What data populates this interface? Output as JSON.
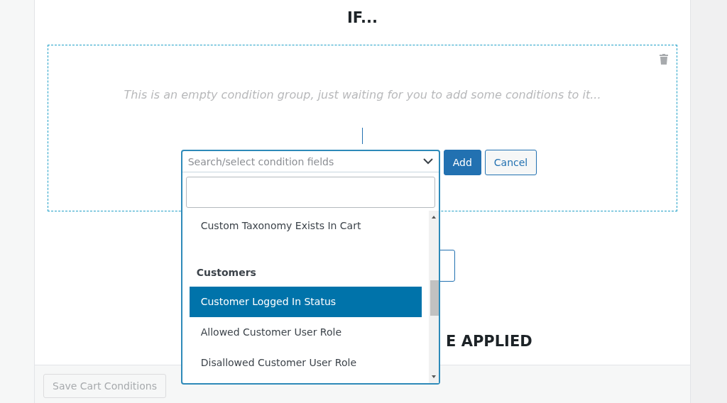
{
  "title": "IF...",
  "condition_group": {
    "empty_message": "This is an empty condition group, just waiting for you to add some conditions to it...",
    "select": {
      "placeholder": "Search/select condition fields",
      "expanded": true,
      "options": [
        {
          "kind": "option",
          "label": "Custom Taxonomy Exists In Cart",
          "selected": false
        },
        {
          "kind": "group",
          "label": "Customers"
        },
        {
          "kind": "option",
          "label": "Customer Logged In Status",
          "selected": true
        },
        {
          "kind": "option",
          "label": "Allowed Customer User Role",
          "selected": false
        },
        {
          "kind": "option",
          "label": "Disallowed Customer User Role",
          "selected": false
        }
      ]
    },
    "buttons": [
      {
        "kind": "primary",
        "label": "Add"
      },
      {
        "kind": "secondary",
        "label": "Cancel"
      }
    ]
  },
  "section_heading": "E APPLIED",
  "footer": {
    "save_button": {
      "label": "Save Cart Conditions",
      "disabled": true
    }
  }
}
